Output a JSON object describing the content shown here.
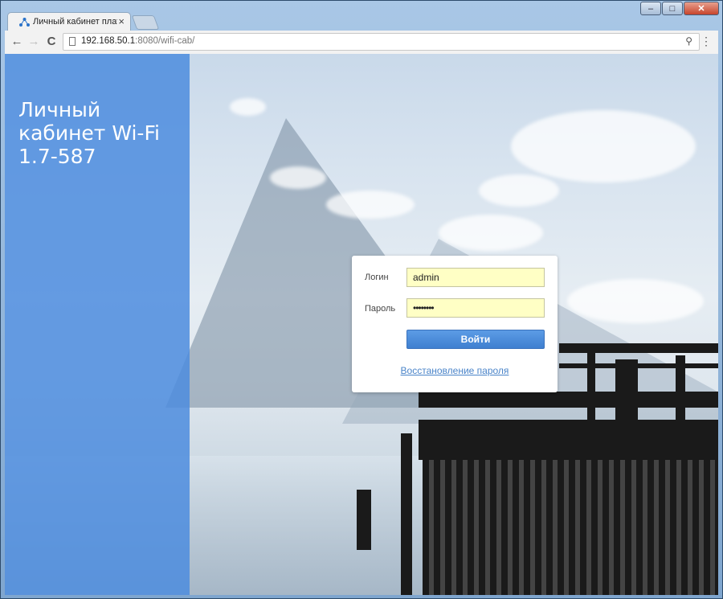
{
  "browser": {
    "tab_title": "Личный кабинет платф",
    "tab_close": "×",
    "back_icon": "←",
    "forward_icon": "→",
    "reload_icon": "C",
    "url_host": "192.168.50.1",
    "url_rest": ":8080/wifi-cab/",
    "key_icon": "⚲",
    "menu_icon": "⋮",
    "window_min": "–",
    "window_max": "□",
    "window_close": "✕"
  },
  "sidebar": {
    "title_line1": "Личный",
    "title_line2": "кабинет Wi-Fi",
    "title_line3": "1.7-587"
  },
  "login": {
    "login_label": "Логин",
    "login_value": "admin",
    "password_label": "Пароль",
    "password_value": "••••••••",
    "submit_label": "Войти",
    "recover_link": "Восстановление пароля"
  },
  "colors": {
    "sidebar": "#4c8cde",
    "button": "#4a8bdb",
    "link": "#4a84c9",
    "input_bg": "#ffffc5"
  }
}
